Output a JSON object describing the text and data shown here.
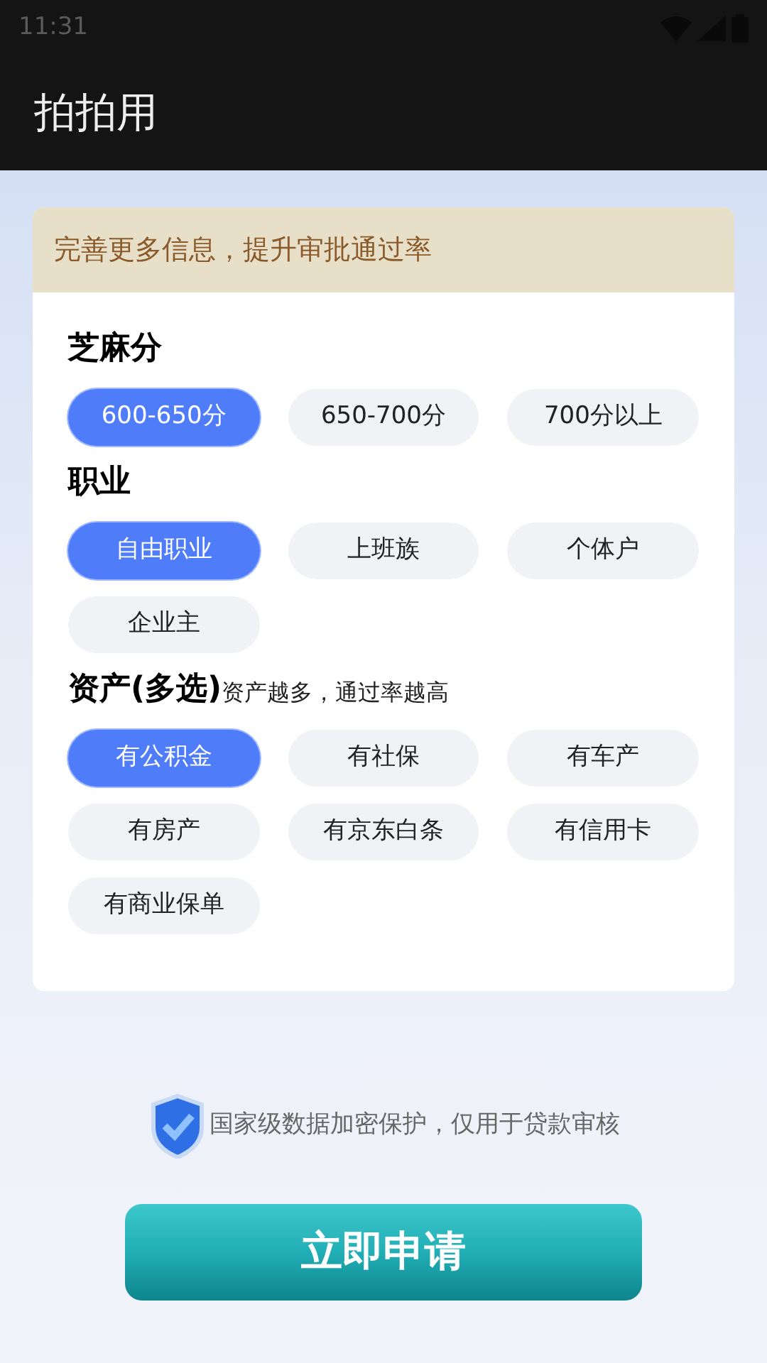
{
  "status_bar": {
    "time": "11:31"
  },
  "app_bar": {
    "title": "拍拍用"
  },
  "card": {
    "banner": "完善更多信息，提升审批通过率",
    "sections": [
      {
        "title": "芝麻分",
        "options": [
          {
            "label": "600-650分",
            "selected": true
          },
          {
            "label": "650-700分",
            "selected": false
          },
          {
            "label": "700分以上",
            "selected": false
          }
        ]
      },
      {
        "title": "职业",
        "options": [
          {
            "label": "自由职业",
            "selected": true
          },
          {
            "label": "上班族",
            "selected": false
          },
          {
            "label": "个体户",
            "selected": false
          },
          {
            "label": "企业主",
            "selected": false
          }
        ]
      },
      {
        "title": "资产(多选)",
        "note": "资产越多，通过率越高",
        "options": [
          {
            "label": "有公积金",
            "selected": true
          },
          {
            "label": "有社保",
            "selected": false
          },
          {
            "label": "有车产",
            "selected": false
          },
          {
            "label": "有房产",
            "selected": false
          },
          {
            "label": "有京东白条",
            "selected": false
          },
          {
            "label": "有信用卡",
            "selected": false
          },
          {
            "label": "有商业保单",
            "selected": false
          }
        ]
      }
    ]
  },
  "security_note": "国家级数据加密保护，仅用于贷款审核",
  "apply_button": "立即申请"
}
